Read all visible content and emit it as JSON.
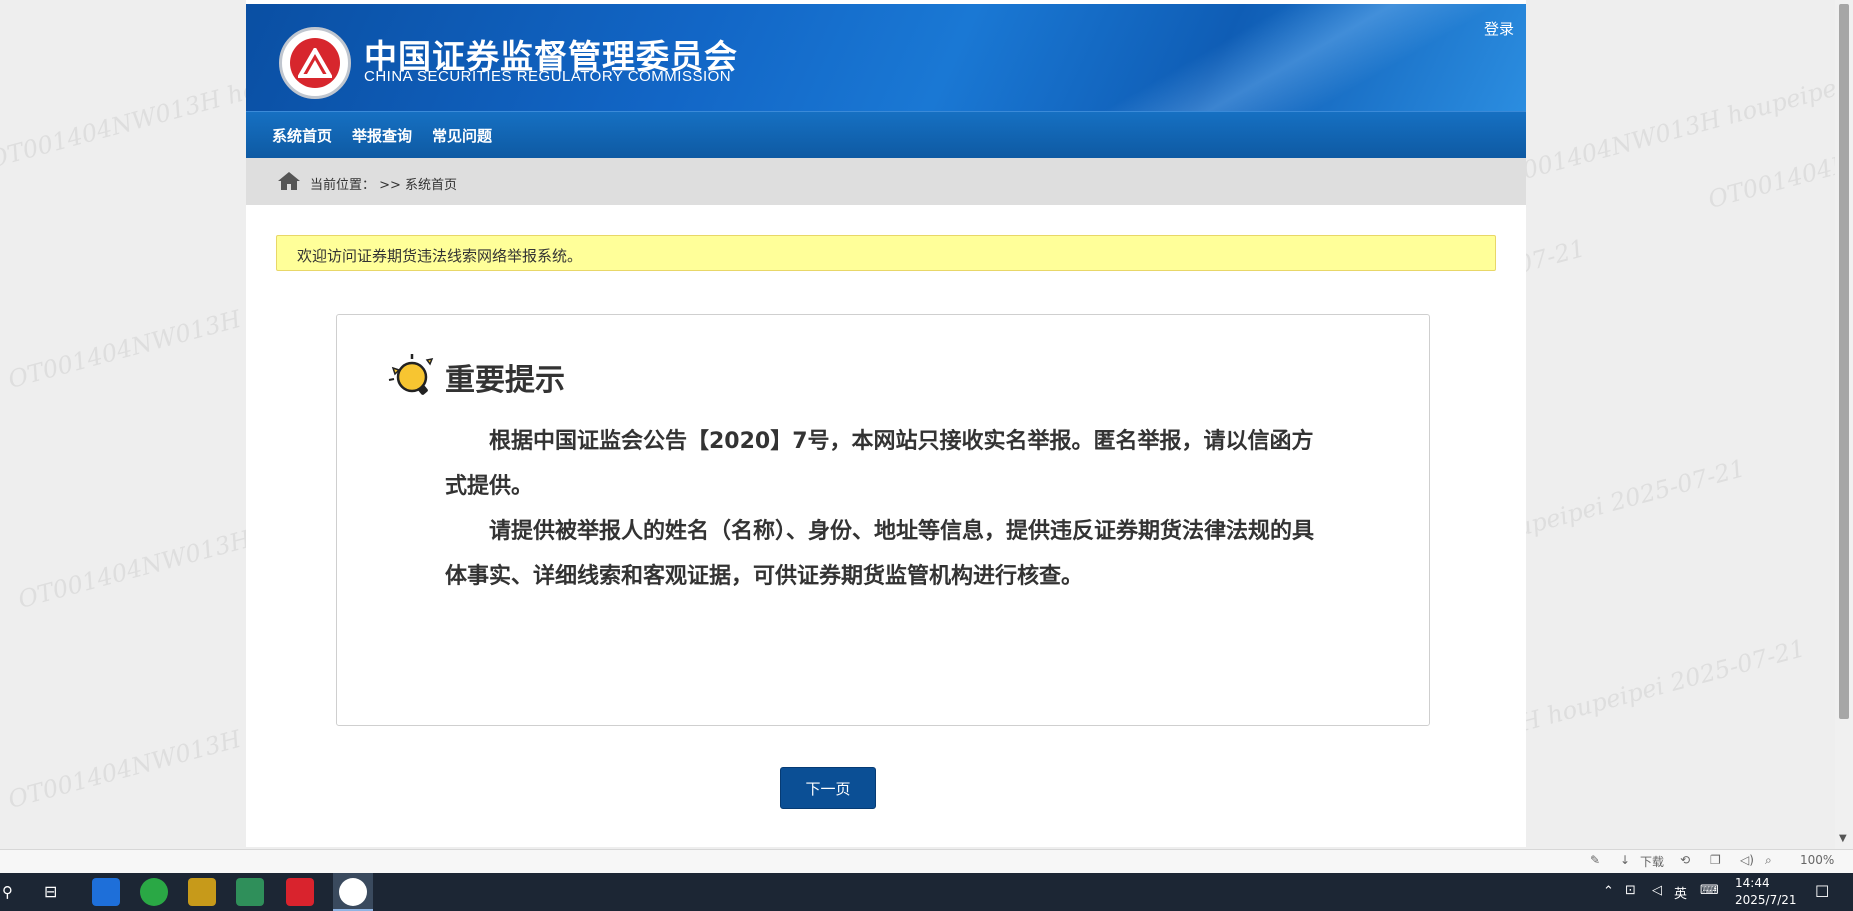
{
  "header": {
    "title_cn": "中国证券监督管理委员会",
    "title_en": "CHINA SECURITIES REGULATORY COMMISSION",
    "login_label": "登录"
  },
  "nav": {
    "items": [
      {
        "label": "系统首页"
      },
      {
        "label": "举报查询"
      },
      {
        "label": "常见问题"
      }
    ]
  },
  "breadcrumb": {
    "text": "当前位置： >> 系统首页"
  },
  "welcome": {
    "text": "欢迎访问证券期货违法线索网络举报系统。"
  },
  "notice": {
    "title": "重要提示",
    "paragraphs": [
      "根据中国证监会公告【2020】7号，本网站只接收实名举报。匿名举报，请以信函方式提供。",
      "请提供被举报人的姓名（名称）、身份、地址等信息，提供违反证券期货法律法规的具体事实、详细线索和客观证据，可供证券期货监管机构进行核查。"
    ]
  },
  "actions": {
    "next_label": "下一页"
  },
  "statusbar": {
    "download_label": "下载",
    "zoom": "100%"
  },
  "taskbar": {
    "time": "14:44",
    "date": "2025/7/21",
    "ime": "英"
  },
  "watermark": {
    "text": "OT001404NW013H houpeipei 2025-07-21"
  }
}
